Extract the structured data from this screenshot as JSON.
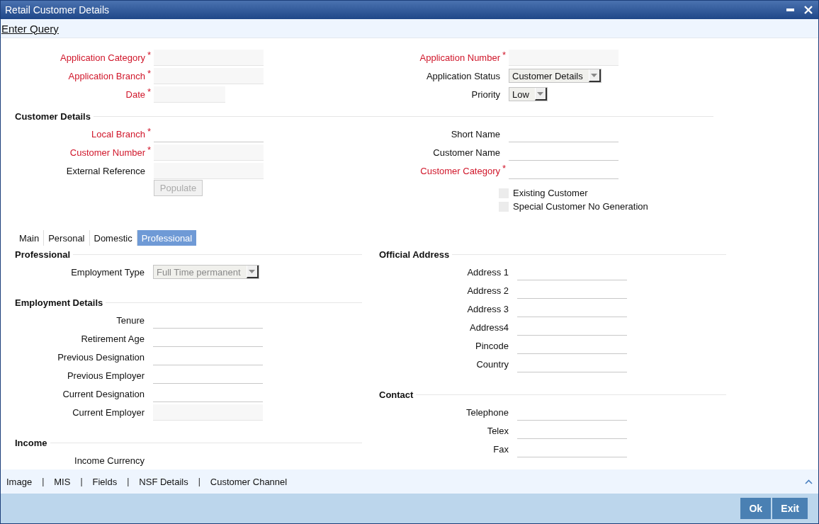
{
  "window": {
    "title": "Retail Customer Details"
  },
  "toolbar": {
    "link": "Enter Query"
  },
  "header": {
    "left": [
      {
        "label": "Application Category",
        "mark": "*",
        "kind": "filled"
      },
      {
        "label": "Application Branch",
        "mark": "*",
        "kind": "filled"
      },
      {
        "label": "Date",
        "mark": "*",
        "kind": "date"
      }
    ],
    "right": [
      {
        "label": "Application Number",
        "mark": "*",
        "kind": "filled"
      },
      {
        "label": "Application Status",
        "kind": "select",
        "value": "Customer Details",
        "disabled": false
      },
      {
        "label": "Priority",
        "kind": "select",
        "value": "Low",
        "disabled": false
      }
    ]
  },
  "customer_details": {
    "title": "Customer Details",
    "left": [
      {
        "label": "Local Branch",
        "mark": "*",
        "kind": "line"
      },
      {
        "label": "Customer Number",
        "mark": "*",
        "kind": "filled"
      },
      {
        "label": "External Reference",
        "kind": "filled"
      }
    ],
    "populate_button": {
      "label": "Populate",
      "disabled": true
    },
    "right": [
      {
        "label": "Short Name",
        "kind": "line"
      },
      {
        "label": "Customer Name",
        "kind": "line"
      },
      {
        "label": "Customer Category",
        "mark": "*",
        "kind": "line"
      }
    ],
    "checkboxes": [
      {
        "label": "Existing Customer",
        "checked": false
      },
      {
        "label": "Special Customer No Generation",
        "checked": false
      }
    ]
  },
  "tabs": [
    {
      "label": "Main",
      "selected": false
    },
    {
      "label": "Personal",
      "selected": false
    },
    {
      "label": "Domestic",
      "selected": false
    },
    {
      "label": "Professional",
      "selected": true
    }
  ],
  "professional": {
    "left": [
      {
        "title": "Professional",
        "fields": [
          {
            "label": "Employment Type",
            "kind": "select",
            "value": "Full Time permanent",
            "disabled": true
          }
        ]
      },
      {
        "title": "Employment Details",
        "fields": [
          {
            "label": "Tenure",
            "kind": "line"
          },
          {
            "label": "Retirement Age",
            "kind": "line"
          },
          {
            "label": "Previous Designation",
            "kind": "line"
          },
          {
            "label": "Previous Employer",
            "kind": "line"
          },
          {
            "label": "Current Designation",
            "kind": "line"
          },
          {
            "label": "Current Employer",
            "kind": "filled"
          }
        ]
      },
      {
        "title": "Income",
        "fields": [
          {
            "label": "Income Currency",
            "kind": "label"
          }
        ]
      }
    ],
    "right": [
      {
        "title": "Official Address",
        "fields": [
          {
            "label": "Address 1",
            "kind": "line"
          },
          {
            "label": "Address 2",
            "kind": "line"
          },
          {
            "label": "Address 3",
            "kind": "line"
          },
          {
            "label": "Address4",
            "kind": "line"
          },
          {
            "label": "Pincode",
            "kind": "line"
          },
          {
            "label": "Country",
            "kind": "line"
          }
        ]
      },
      {
        "title": "Contact",
        "fields": [
          {
            "label": "Telephone",
            "kind": "line"
          },
          {
            "label": "Telex",
            "kind": "line"
          },
          {
            "label": "Fax",
            "kind": "line"
          }
        ]
      }
    ]
  },
  "footer_items": [
    {
      "kind": "link",
      "text": "Image"
    },
    {
      "kind": "separator",
      "text": "|"
    },
    {
      "kind": "link",
      "text": "MIS"
    },
    {
      "kind": "separator",
      "text": "|"
    },
    {
      "kind": "link",
      "text": "Fields"
    },
    {
      "kind": "separator",
      "text": "|"
    },
    {
      "kind": "link",
      "text": "NSF Details"
    },
    {
      "kind": "separator",
      "text": "|"
    },
    {
      "kind": "link",
      "text": "Customer Channel"
    }
  ],
  "buttons": [
    "Ok",
    "Exit"
  ]
}
